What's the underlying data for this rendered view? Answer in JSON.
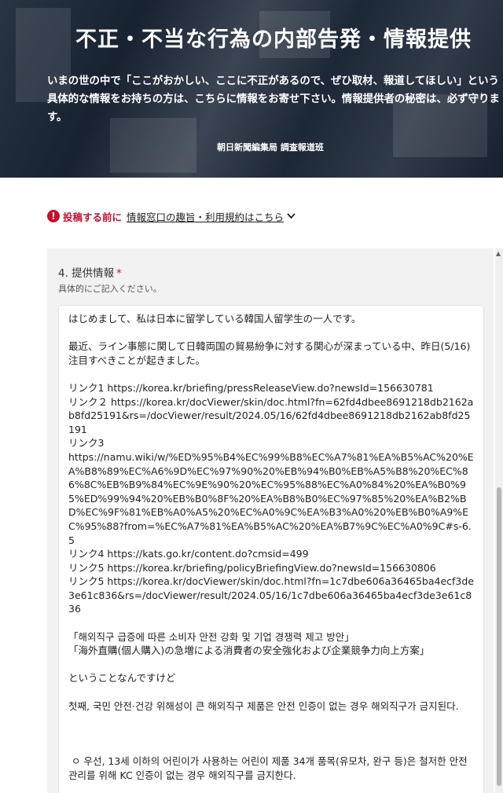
{
  "hero": {
    "title": "不正・不当な行為の内部告発・情報提供",
    "description": "いまの世の中で「ここがおかしい、ここに不正があるので、ぜひ取材、報道してほしい」という具体的な情報をお持ちの方は、こちらに情報をお寄せ下さい。情報提供者の秘密は、必ず守ります。",
    "credit": "朝日新聞編集局 調査報道班"
  },
  "notice": {
    "lead": "投稿する前に",
    "link": "情報窓口の趣旨・利用規約はこちら"
  },
  "form": {
    "question_label": "4. 提供情報",
    "required_mark": "*",
    "hint": "具体的にご記入ください。",
    "textarea_value": "はじめまして、私は日本に留学している韓国人留学生の一人です。\n\n最近、ライン事態に関して日韓両国の貿易紛争に対する関心が深まっている中、昨日(5/16)注目すべきことが起きました。\n\nリンク1 https://korea.kr/briefing/pressReleaseView.do?newsId=156630781\nリンク２ https://korea.kr/docViewer/skin/doc.html?fn=62fd4dbee8691218db2162ab8fd25191&rs=/docViewer/result/2024.05/16/62fd4dbee8691218db2162ab8fd25191\nリンク3\nhttps://namu.wiki/w/%ED%95%B4%EC%99%B8%EC%A7%81%EA%B5%AC%20%EA%B8%89%EC%A6%9D%EC%97%90%20%EB%94%B0%EB%A5%B8%20%EC%86%8C%EB%B9%84%EC%9E%90%20%EC%95%88%EC%A0%84%20%EA%B0%95%ED%99%94%20%EB%B0%8F%20%EA%B8%B0%EC%97%85%20%EA%B2%BD%EC%9F%81%EB%A0%A5%20%EC%A0%9C%EA%B3%A0%20%EB%B0%A9%EC%95%88?from=%EC%A7%81%EA%B5%AC%20%EA%B7%9C%EC%A0%9C#s-6.5\nリンク4 https://kats.go.kr/content.do?cmsid=499\nリンク5 https://korea.kr/briefing/policyBriefingView.do?newsId=156630806\nリンク5 https://korea.kr/docViewer/skin/doc.html?fn=1c7dbe606a36465ba4ecf3de3e61c836&rs=/docViewer/result/2024.05/16/1c7dbe606a36465ba4ecf3de3e61c836\n\n「해외직구 급증에 따른 소비자 안전 강화 및 기업 경쟁력 제고 방안」\n「海外直購(個人購入)の急増による消費者の安全強化および企業競争力向上方案」\n\nということなんですけど\n\n첫째, 국민 안전·건강 위해성이 큰 해외직구 제품은 안전 인증이 없는 경우 해외직구가 금지된다.\n\n\n\n ㅇ 우선, 13세 이하의 어린이가 사용하는 어린이 제품 34개 품목(유모차, 완구 등)은 철저한 안전관리를 위해 KC 인증이 없는 경우 해외직구를 금지한다."
  },
  "icons": {
    "alert": "exclamation-icon",
    "chevron": "chevron-down-icon",
    "scroll_up": "arrow-up-icon"
  },
  "colors": {
    "accent_red": "#c8102e",
    "panel_bg": "#f2f2f2",
    "hero_overlay": "#0a121e"
  }
}
